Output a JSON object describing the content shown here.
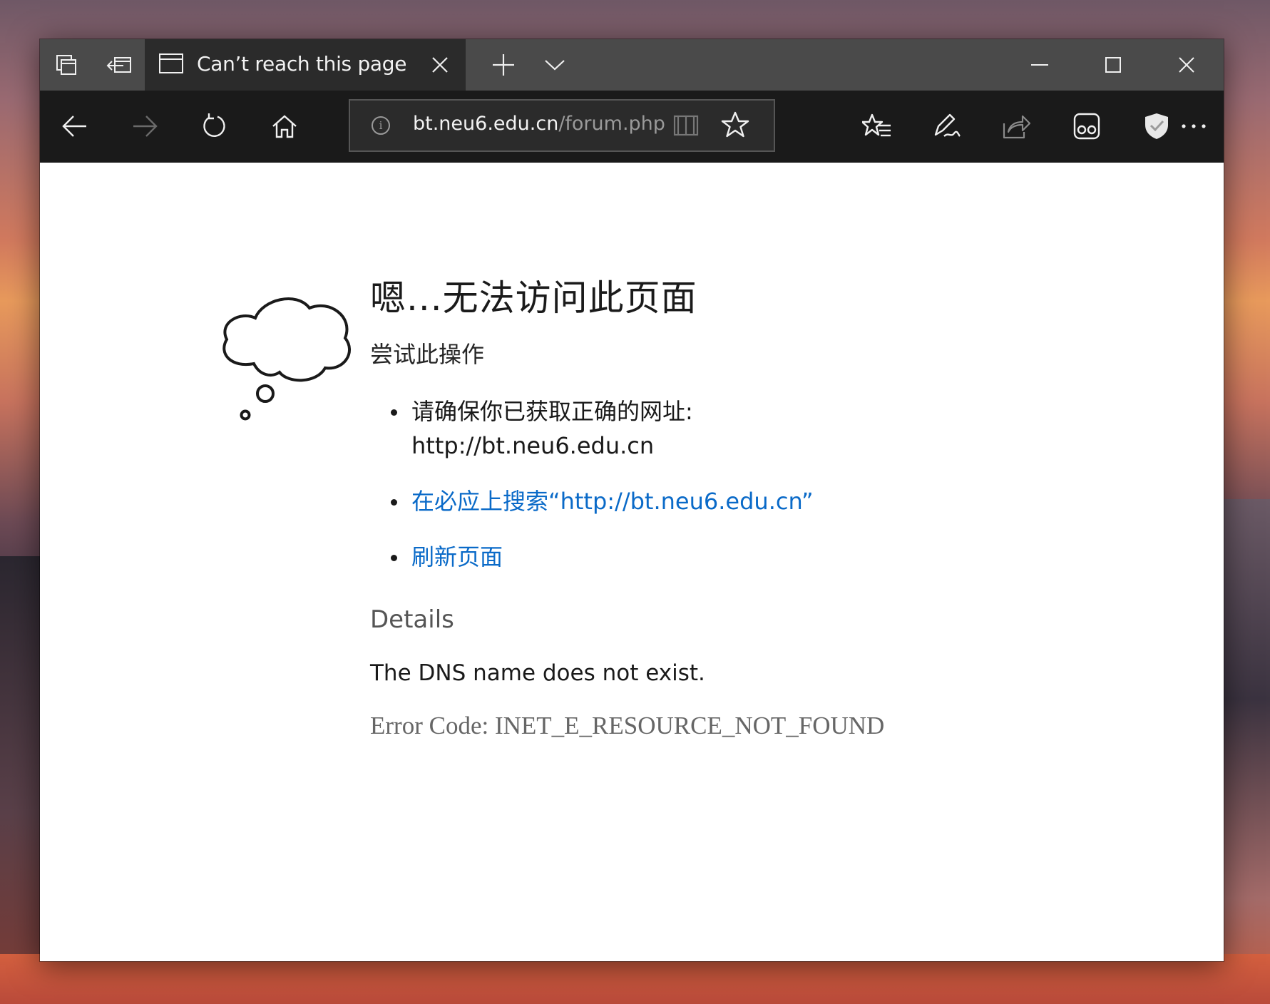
{
  "tabs": {
    "active_title": "Can’t reach this page"
  },
  "address_bar": {
    "host": "bt.neu6.edu.cn",
    "path": "/forum.php",
    "info_glyph": "i"
  },
  "icons": {
    "tab_switcher": "tab-switcher-icon",
    "set_aside": "set-aside-tabs-icon",
    "new_tab": "plus-icon",
    "tab_preview": "chevron-down-icon",
    "back": "back-arrow-icon",
    "forward": "forward-arrow-icon",
    "refresh": "refresh-icon",
    "home": "home-icon",
    "reading_view": "book-icon",
    "favorite": "star-icon",
    "favorites_hub": "favorites-list-icon",
    "web_note": "pen-icon",
    "share": "share-icon",
    "extension_1": "extension-icon",
    "extension_2": "shield-icon",
    "more": "more-icon",
    "cloud": "thought-cloud-icon"
  },
  "page": {
    "heading": "嗯...无法访问此页面",
    "try_label": "尝试此操作",
    "bullets": {
      "check_url": "请确保你已获取正确的网址:",
      "check_url_value": "http://bt.neu6.edu.cn",
      "search_link": "在必应上搜索“http://bt.neu6.edu.cn”",
      "refresh_link": "刷新页面"
    },
    "details_heading": "Details",
    "details_text": "The DNS name does not exist.",
    "error_code": "Error Code: INET_E_RESOURCE_NOT_FOUND"
  },
  "colors": {
    "titlebar": "#4a4a4a",
    "active_tab": "#2b2b2b",
    "toolbar": "#1a1a1a",
    "link": "#0a6ac8"
  }
}
